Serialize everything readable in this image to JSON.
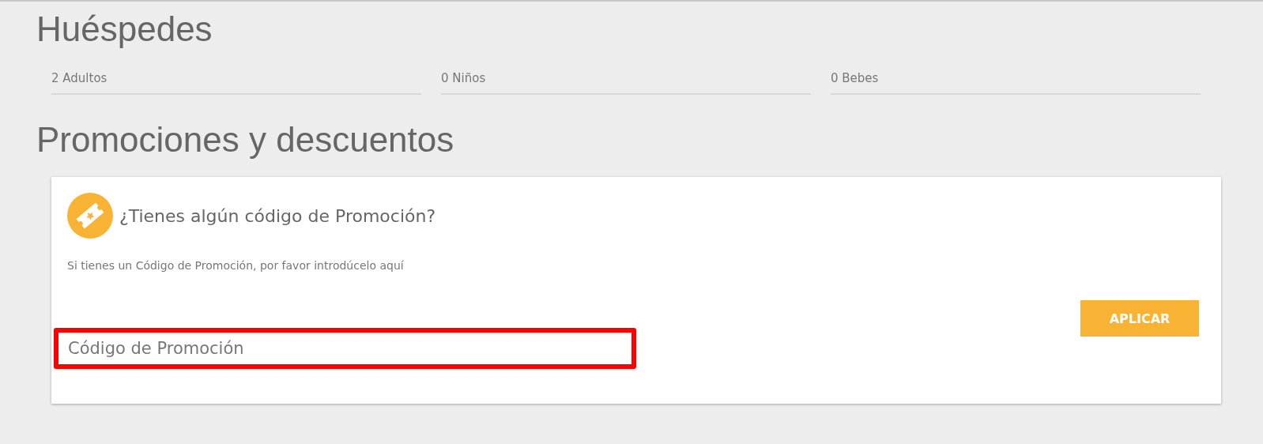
{
  "guests": {
    "title": "Huéspedes",
    "fields": [
      {
        "value": "2 Adultos"
      },
      {
        "value": "0 Niños"
      },
      {
        "value": "0 Bebes"
      }
    ]
  },
  "promotions": {
    "title": "Promociones y descuentos",
    "card": {
      "title": "¿Tienes algún código de Promoción?",
      "hint": "Si tienes un Código de Promoción, por favor introdúcelo aquí",
      "button": "APLICAR",
      "code_field": {
        "placeholder": "Código de Promoción",
        "highlighted": true
      }
    }
  }
}
